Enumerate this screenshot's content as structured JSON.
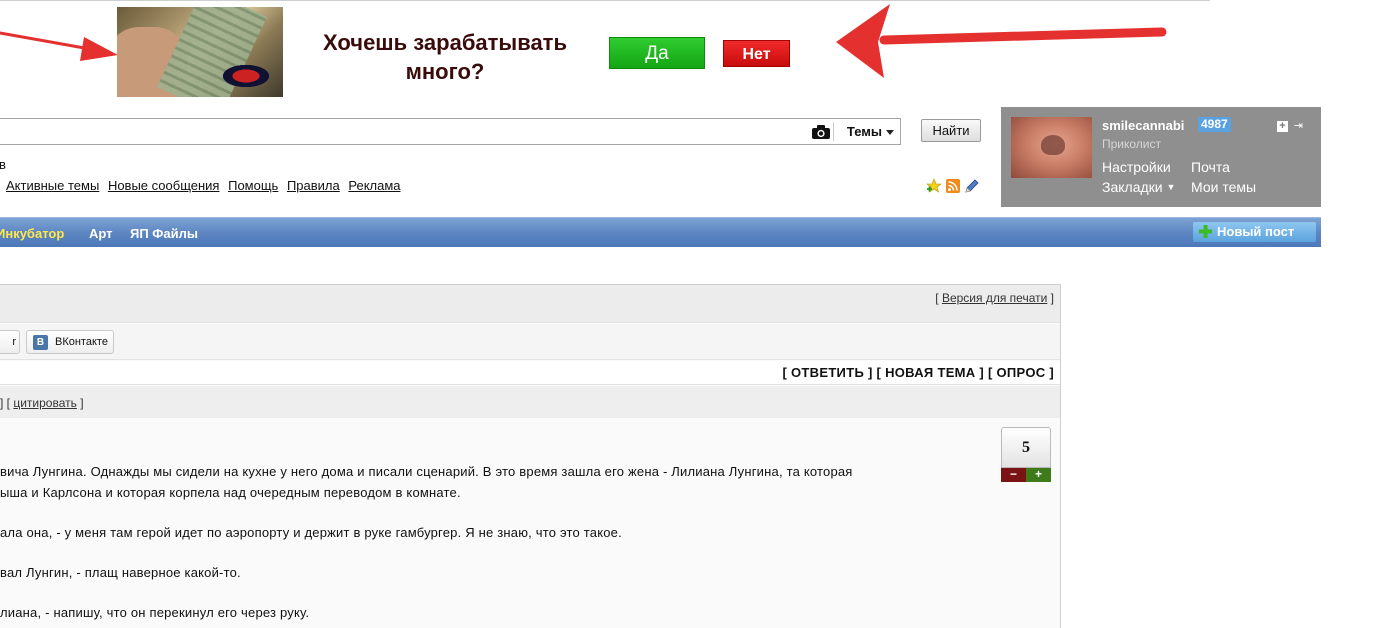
{
  "banner": {
    "title": "Хочешь зарабатывать много?",
    "yes_label": "Да",
    "no_label": "Нет",
    "colors": {
      "yes": "#1db91d",
      "no": "#e01515",
      "arrow": "#e53030"
    }
  },
  "search": {
    "value": "",
    "scope_label": "Темы",
    "find_label": "Найти"
  },
  "header": {
    "fragment": "в",
    "links": [
      "Активные темы",
      "Новые сообщения",
      "Помощь",
      "Правила",
      "Реклама"
    ]
  },
  "user": {
    "name": "smilecannabi",
    "karma": "4987",
    "rank": "Приколист",
    "links": {
      "settings": "Настройки",
      "mail": "Почта",
      "bookmarks": "Закладки",
      "my_topics": "Мои темы"
    }
  },
  "nav": {
    "items": [
      "Инкубатор",
      "Арт",
      "ЯП Файлы"
    ],
    "new_post": "Новый пост"
  },
  "topic": {
    "print_prefix": "[",
    "print_label": "Версия для печати",
    "print_suffix": "]",
    "share_partial": "r",
    "share_vk": "ВКонтакте",
    "vk_letter": "B",
    "actions": "[ ОТВЕТИТЬ ] [ НОВАЯ ТЕМА ] [ ОПРОС ]",
    "quote_prefix": "] [",
    "quote_label": "цитировать",
    "quote_suffix": "]",
    "rating": "5",
    "vote_minus": "−",
    "vote_plus": "+",
    "lines": [
      "вича Лунгина. Однажды мы сидели на кухне у него дома и писали сценарий. В это время зашла его жена - Лилиана Лунгина, та которая",
      "ыша и Карлсона и которая корпела над очередным переводом в комнате.",
      "ала она, - у меня там герой идет по аэропорту и держит в руке гамбургер. Я не знаю, что это такое.",
      "вал Лунгин, - плащ наверное какой-то.",
      "лиана, - напишу, что он перекинул его через руку."
    ]
  }
}
